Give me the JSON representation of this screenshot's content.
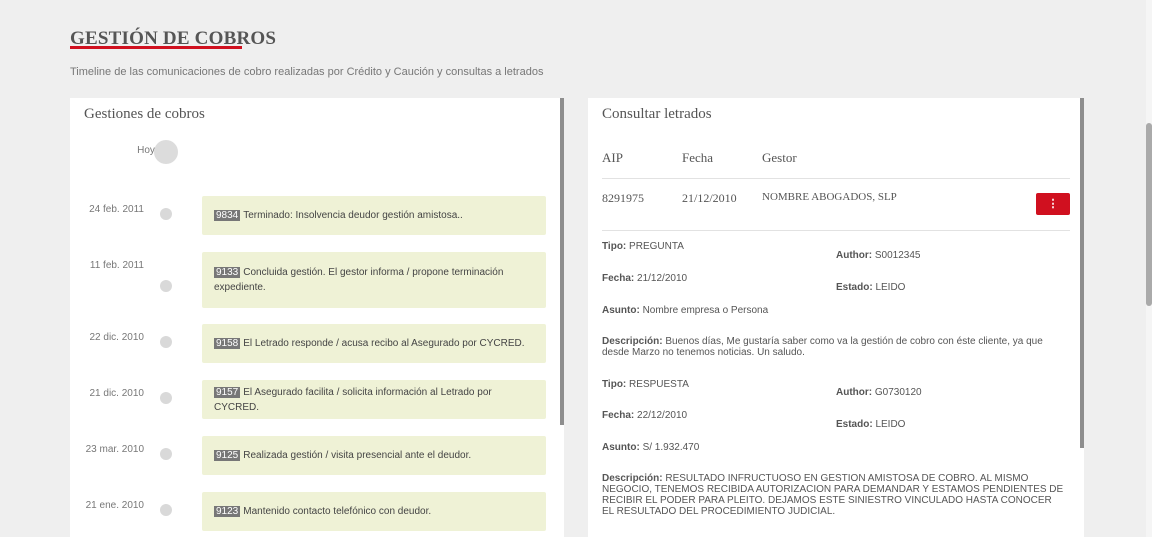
{
  "page": {
    "title": "GESTIÓN DE COBROS",
    "subtitle": "Timeline de las comunicaciones de cobro realizadas por Crédito y Caución y consultas a letrados"
  },
  "gestiones": {
    "heading": "Gestiones de cobros",
    "today_label": "Hoy",
    "entries": [
      {
        "date": "24 feb. 2011",
        "code": "9834",
        "text": "Terminado: Insolvencia deudor gestión amistosa.."
      },
      {
        "date": "11 feb. 2011",
        "code": "9133",
        "text": "Concluida gestión. El gestor informa / propone terminación expediente."
      },
      {
        "date": "22 dic. 2010",
        "code": "9158",
        "text": "El Letrado responde / acusa recibo al Asegurado por CYCRED."
      },
      {
        "date": "21 dic. 2010",
        "code": "9157",
        "text": "El Asegurado facilita / solicita información al Letrado por CYCRED."
      },
      {
        "date": "23 mar. 2010",
        "code": "9125",
        "text": "Realizada gestión / visita presencial ante el deudor."
      },
      {
        "date": "21 ene. 2010",
        "code": "9123",
        "text": "Mantenido contacto telefónico con deudor."
      }
    ]
  },
  "letrados": {
    "heading": "Consultar letrados",
    "columns": [
      "AIP",
      "Fecha",
      "Gestor"
    ],
    "row": {
      "aip": "8291975",
      "fecha": "21/12/2010",
      "gestor": "NOMBRE ABOGADOS, SLP",
      "menu_icon": "⋮"
    },
    "labels": {
      "tipo": "Tipo:",
      "author": "Author:",
      "fecha": "Fecha:",
      "estado": "Estado:",
      "asunto": "Asunto:",
      "descripcion": "Descripción:"
    },
    "messages": [
      {
        "tipo": "PREGUNTA",
        "author": "S0012345",
        "fecha": "21/12/2010",
        "estado": "LEIDO",
        "asunto": "Nombre empresa o Persona",
        "descripcion": "Buenos días, Me gustaría saber como va la gestión de cobro con éste cliente, ya que desde Marzo no tenemos noticias. Un saludo."
      },
      {
        "tipo": "RESPUESTA",
        "author": "G0730120",
        "fecha": "22/12/2010",
        "estado": "LEIDO",
        "asunto": "S/ 1.932.470",
        "descripcion": "RESULTADO INFRUCTUOSO EN GESTION AMISTOSA DE COBRO. AL MISMO NEGOCIO, TENEMOS RECIBIDA AUTORIZACION PARA DEMANDAR Y ESTAMOS PENDIENTES DE RECIBIR EL PODER PARA PLEITO. DEJAMOS ESTE SINIESTRO VINCULADO HASTA CONOCER EL RESULTADO DEL PROCEDIMIENTO JUDICIAL."
      }
    ]
  },
  "colors": {
    "accent": "#d0101f",
    "entry_bg": "#eff2d6",
    "page_bg": "#efefef"
  }
}
